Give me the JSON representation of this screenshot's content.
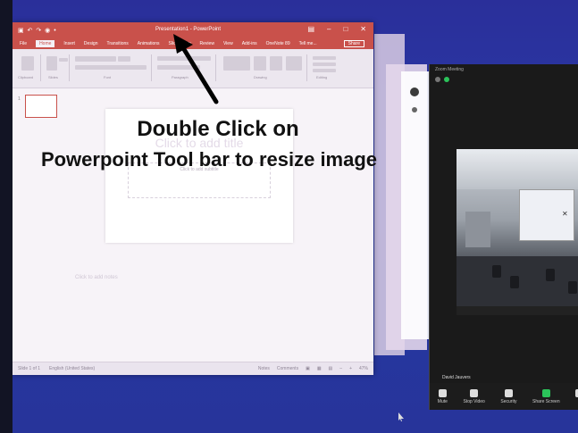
{
  "powerpoint": {
    "qat": "▣ ↶ ↷ ◉ •",
    "doc_title": "Presentation1 - PowerPoint",
    "window_controls": [
      "▤",
      "–",
      "□",
      "✕"
    ],
    "tabs": [
      "File",
      "Home",
      "Insert",
      "Design",
      "Transitions",
      "Animations",
      "Slide Show",
      "Review",
      "View",
      "Add-ins",
      "OneNote 89",
      "Tell me...",
      "Share"
    ],
    "active_tab": "Home",
    "ribbon_groups": [
      "Clipboard",
      "Slides",
      "Font",
      "Paragraph",
      "Drawing",
      "Editing"
    ],
    "slide_number": "1",
    "slide_title_placeholder": "Click to add title",
    "slide_subtitle_placeholder": "Click to add subtitle",
    "notes_placeholder": "Click to add notes",
    "status_left": [
      "Slide 1 of 1",
      "English (United States)"
    ],
    "status_right": [
      "Notes",
      "Comments",
      "▣",
      "▦",
      "▤",
      "–",
      "+",
      "47%"
    ]
  },
  "zoom": {
    "title": "Zoom Meeting",
    "participant_name": "David Jauvers",
    "toolbar": [
      {
        "label": "Mute",
        "icon": "microphone-icon"
      },
      {
        "label": "Stop Video",
        "icon": "video-camera-icon"
      },
      {
        "label": "Security",
        "icon": "shield-icon"
      },
      {
        "label": "Share Screen",
        "icon": "share-screen-icon"
      },
      {
        "label": "M",
        "icon": "more-icon"
      }
    ],
    "video_center_glyph": "✕"
  },
  "annotation": {
    "line1": "Double Click on",
    "line2": "Powerpoint Tool bar to resize image"
  },
  "colors": {
    "desktop": "#2b3aa8",
    "powerpoint_accent": "#c9514b",
    "zoom_share_accent": "#2bc35a"
  }
}
